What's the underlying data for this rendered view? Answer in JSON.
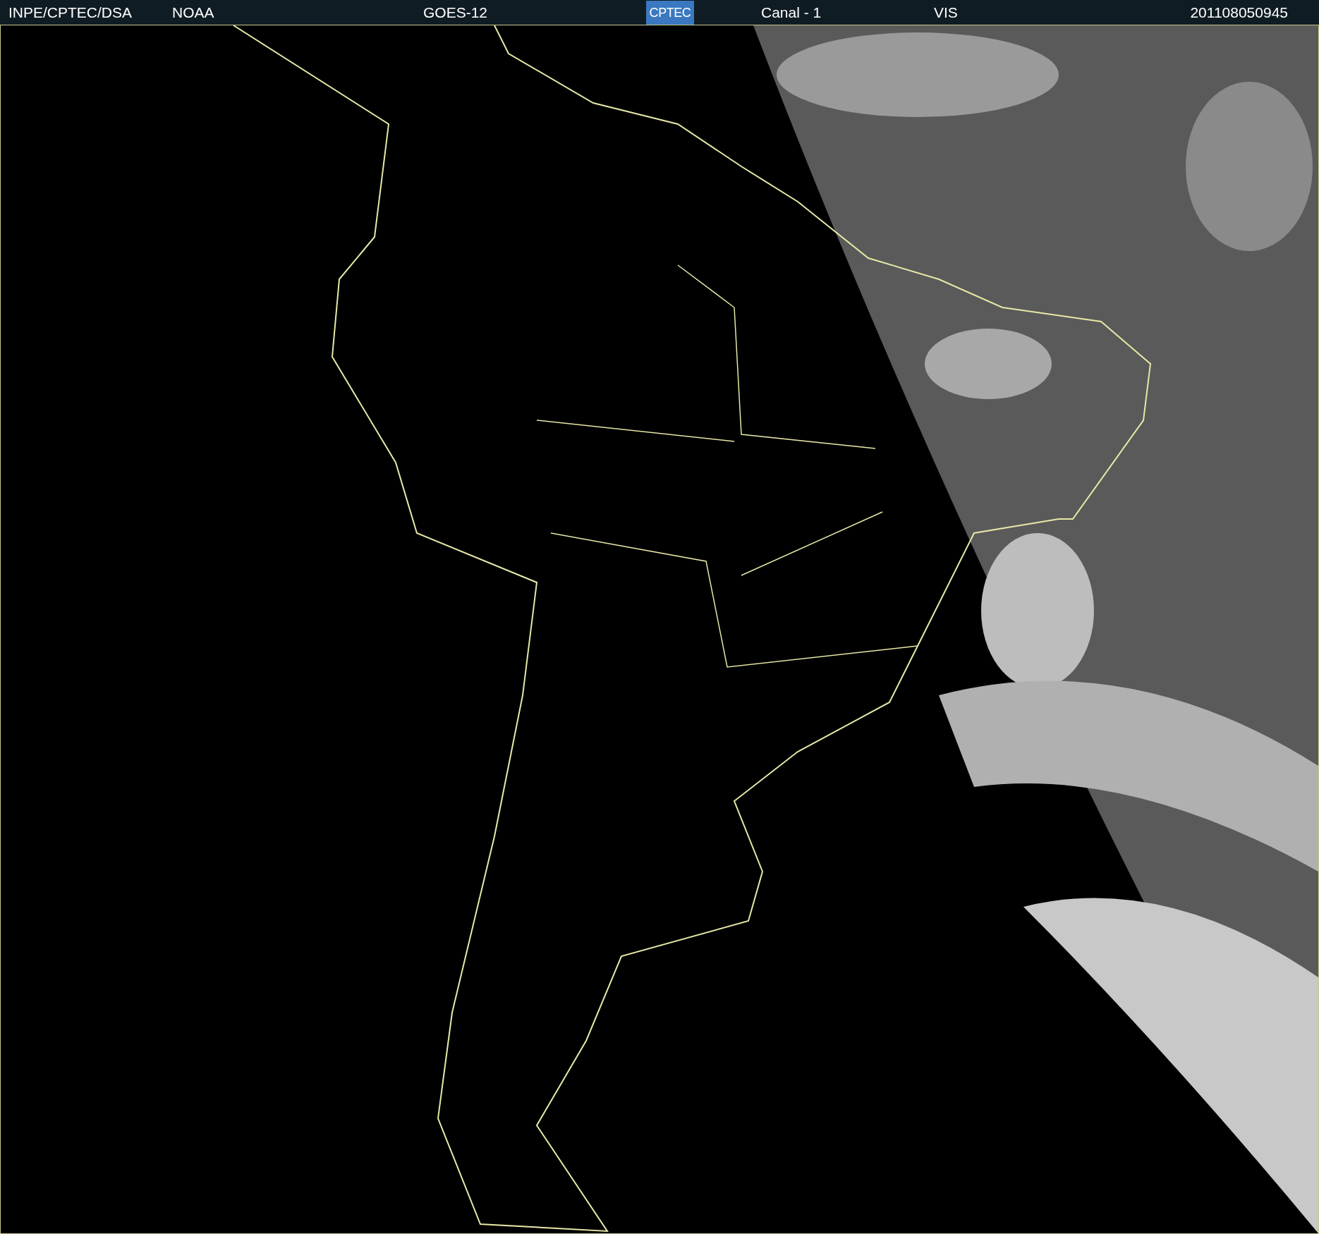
{
  "header": {
    "items": [
      {
        "kind": "text",
        "text": "INPE/CPTEC/DSA"
      },
      {
        "kind": "text",
        "text": "NOAA"
      },
      {
        "kind": "text",
        "text": "GOES-12"
      },
      {
        "kind": "logo",
        "text": "CPTEC"
      },
      {
        "kind": "text",
        "text": "Canal - 1"
      },
      {
        "kind": "text",
        "text": "VIS"
      },
      {
        "kind": "text",
        "text": "201108050945"
      }
    ]
  }
}
